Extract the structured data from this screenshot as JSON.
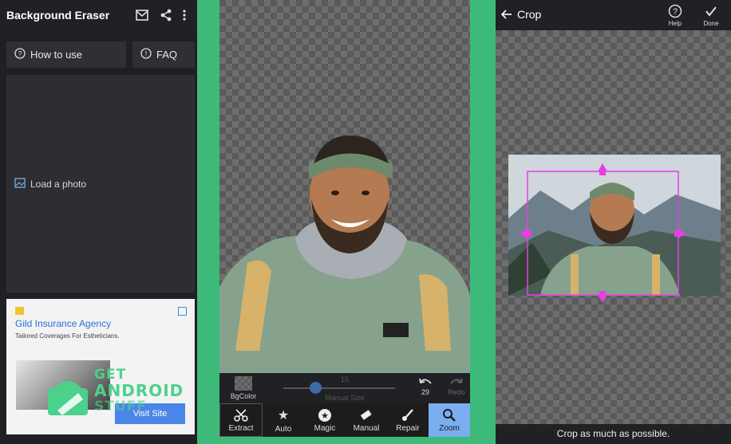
{
  "panel1": {
    "title": "Background Eraser",
    "icons": [
      "mail-icon",
      "share-icon",
      "more-vert-icon"
    ],
    "how_to_use": "How to use",
    "faq": "FAQ",
    "load_photo": "Load a photo",
    "ad": {
      "title": "Gild Insurance Agency",
      "subtitle": "Tailored Coverages For Estheticians.",
      "button": "Visit Site"
    }
  },
  "panel2": {
    "bg_color_label": "BgColor",
    "slider_value": "15",
    "slider_label": "Manual Size",
    "undo_count": "29",
    "redo_label": "Redo",
    "tools": [
      {
        "label": "Extract",
        "icon": "scissors-icon"
      },
      {
        "label": "Auto",
        "icon": "star-icon"
      },
      {
        "label": "Magic",
        "icon": "magic-star-icon"
      },
      {
        "label": "Manual",
        "icon": "eraser-icon"
      },
      {
        "label": "Repair",
        "icon": "brush-icon"
      },
      {
        "label": "Zoom",
        "icon": "zoom-icon"
      }
    ],
    "selected_tool": "Zoom"
  },
  "panel3": {
    "title": "Crop",
    "help_label": "Help",
    "done_label": "Done",
    "hint": "Crop as much as possible."
  },
  "watermark": {
    "line1": "GET",
    "line2": "ANDROID",
    "line3": "STUFF"
  },
  "colors": {
    "accent_green": "#3dba7a",
    "crop_handle": "#e83ee8",
    "selected_tool": "#7aaef0",
    "ad_link": "#2a6fd6"
  }
}
